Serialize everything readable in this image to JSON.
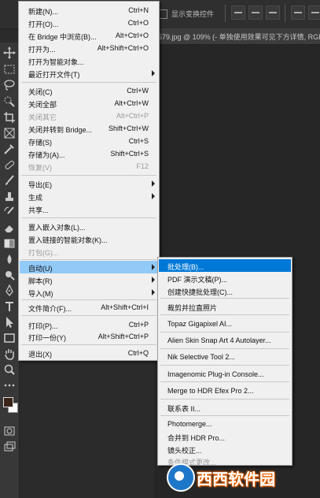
{
  "options": {
    "show_transform_label": "显示变换控件"
  },
  "document_tab": "579.jpg @ 109% (- 单独使用效果可见下方详情, RGB/",
  "file_menu": [
    {
      "label": "新建(N)...",
      "shortcut": "Ctrl+N",
      "state": "normal"
    },
    {
      "label": "打开(O)...",
      "shortcut": "Ctrl+O",
      "state": "normal"
    },
    {
      "label": "在 Bridge 中浏览(B)...",
      "shortcut": "Alt+Ctrl+O",
      "state": "normal"
    },
    {
      "label": "打开为...",
      "shortcut": "Alt+Shift+Ctrl+O",
      "state": "normal"
    },
    {
      "label": "打开为智能对象...",
      "shortcut": "",
      "state": "normal"
    },
    {
      "label": "最近打开文件(T)",
      "shortcut": "",
      "state": "normal",
      "submenu": true
    },
    {
      "label": "关闭(C)",
      "shortcut": "Ctrl+W",
      "state": "normal"
    },
    {
      "label": "关闭全部",
      "shortcut": "Alt+Ctrl+W",
      "state": "normal"
    },
    {
      "label": "关闭其它",
      "shortcut": "Alt+Ctrl+P",
      "state": "disabled"
    },
    {
      "label": "关闭并转到 Bridge...",
      "shortcut": "Shift+Ctrl+W",
      "state": "normal"
    },
    {
      "label": "存储(S)",
      "shortcut": "Ctrl+S",
      "state": "normal"
    },
    {
      "label": "存储为(A)...",
      "shortcut": "Shift+Ctrl+S",
      "state": "normal"
    },
    {
      "label": "恢复(V)",
      "shortcut": "F12",
      "state": "disabled"
    },
    {
      "label": "导出(E)",
      "shortcut": "",
      "state": "normal",
      "submenu": true
    },
    {
      "label": "生成",
      "shortcut": "",
      "state": "normal",
      "submenu": true
    },
    {
      "label": "共享...",
      "shortcut": "",
      "state": "normal"
    },
    {
      "label": "置入嵌入对象(L)...",
      "shortcut": "",
      "state": "normal"
    },
    {
      "label": "置入链接的智能对象(K)...",
      "shortcut": "",
      "state": "normal"
    },
    {
      "label": "打包(G)...",
      "shortcut": "",
      "state": "disabled"
    },
    {
      "label": "自动(U)",
      "shortcut": "",
      "state": "highlighted",
      "submenu": true
    },
    {
      "label": "脚本(R)",
      "shortcut": "",
      "state": "normal",
      "submenu": true
    },
    {
      "label": "导入(M)",
      "shortcut": "",
      "state": "normal",
      "submenu": true
    },
    {
      "label": "文件简介(F)...",
      "shortcut": "Alt+Shift+Ctrl+I",
      "state": "normal"
    },
    {
      "label": "打印(P)...",
      "shortcut": "Ctrl+P",
      "state": "normal"
    },
    {
      "label": "打印一份(Y)",
      "shortcut": "Alt+Shift+Ctrl+P",
      "state": "normal"
    },
    {
      "label": "退出(X)",
      "shortcut": "Ctrl+Q",
      "state": "normal"
    }
  ],
  "automate_submenu": [
    {
      "label": "批处理(B)...",
      "state": "selected"
    },
    {
      "label": "PDF 演示文稿(P)...",
      "state": "normal"
    },
    {
      "label": "创建快捷批处理(C)...",
      "state": "normal"
    },
    {
      "label": "裁剪并拉直照片",
      "state": "normal"
    },
    {
      "label": "Topaz Gigapixel AI...",
      "state": "normal"
    },
    {
      "label": "Alien Skin Snap Art 4 Autolayer...",
      "state": "normal"
    },
    {
      "label": "Nik Selective Tool 2...",
      "state": "normal"
    },
    {
      "label": "Imagenomic Plug-in Console...",
      "state": "normal"
    },
    {
      "label": "Merge to HDR Efex Pro 2...",
      "state": "normal"
    },
    {
      "label": "联系表 II...",
      "state": "normal"
    },
    {
      "label": "Photomerge...",
      "state": "normal"
    },
    {
      "label": "合并到 HDR Pro...",
      "state": "normal"
    },
    {
      "label": "镜头校正...",
      "state": "normal"
    },
    {
      "label": "条件模式更改...",
      "state": "disabled"
    }
  ],
  "watermark_text": "西西软件园",
  "icons": [
    "move-icon",
    "marquee-icon",
    "lasso-icon",
    "quick-select-icon",
    "crop-icon",
    "frame-icon",
    "eyedropper-icon",
    "healing-icon",
    "brush-icon",
    "stamp-icon",
    "history-brush-icon",
    "eraser-icon",
    "gradient-icon",
    "blur-icon",
    "dodge-icon",
    "pen-icon",
    "type-icon",
    "path-select-icon",
    "rectangle-icon",
    "hand-icon",
    "zoom-icon",
    "more-tools-icon",
    "color-swatches",
    "quick-mask-icon",
    "screen-mode-icon"
  ],
  "colors": {
    "menu_bg": "#f0f0f0",
    "menu_hover": "#91c9f7",
    "menu_selected": "#0078d7",
    "app_bg": "#2b2b2b",
    "foreground_swatch": "#3a2318",
    "background_swatch": "#ffffff"
  }
}
